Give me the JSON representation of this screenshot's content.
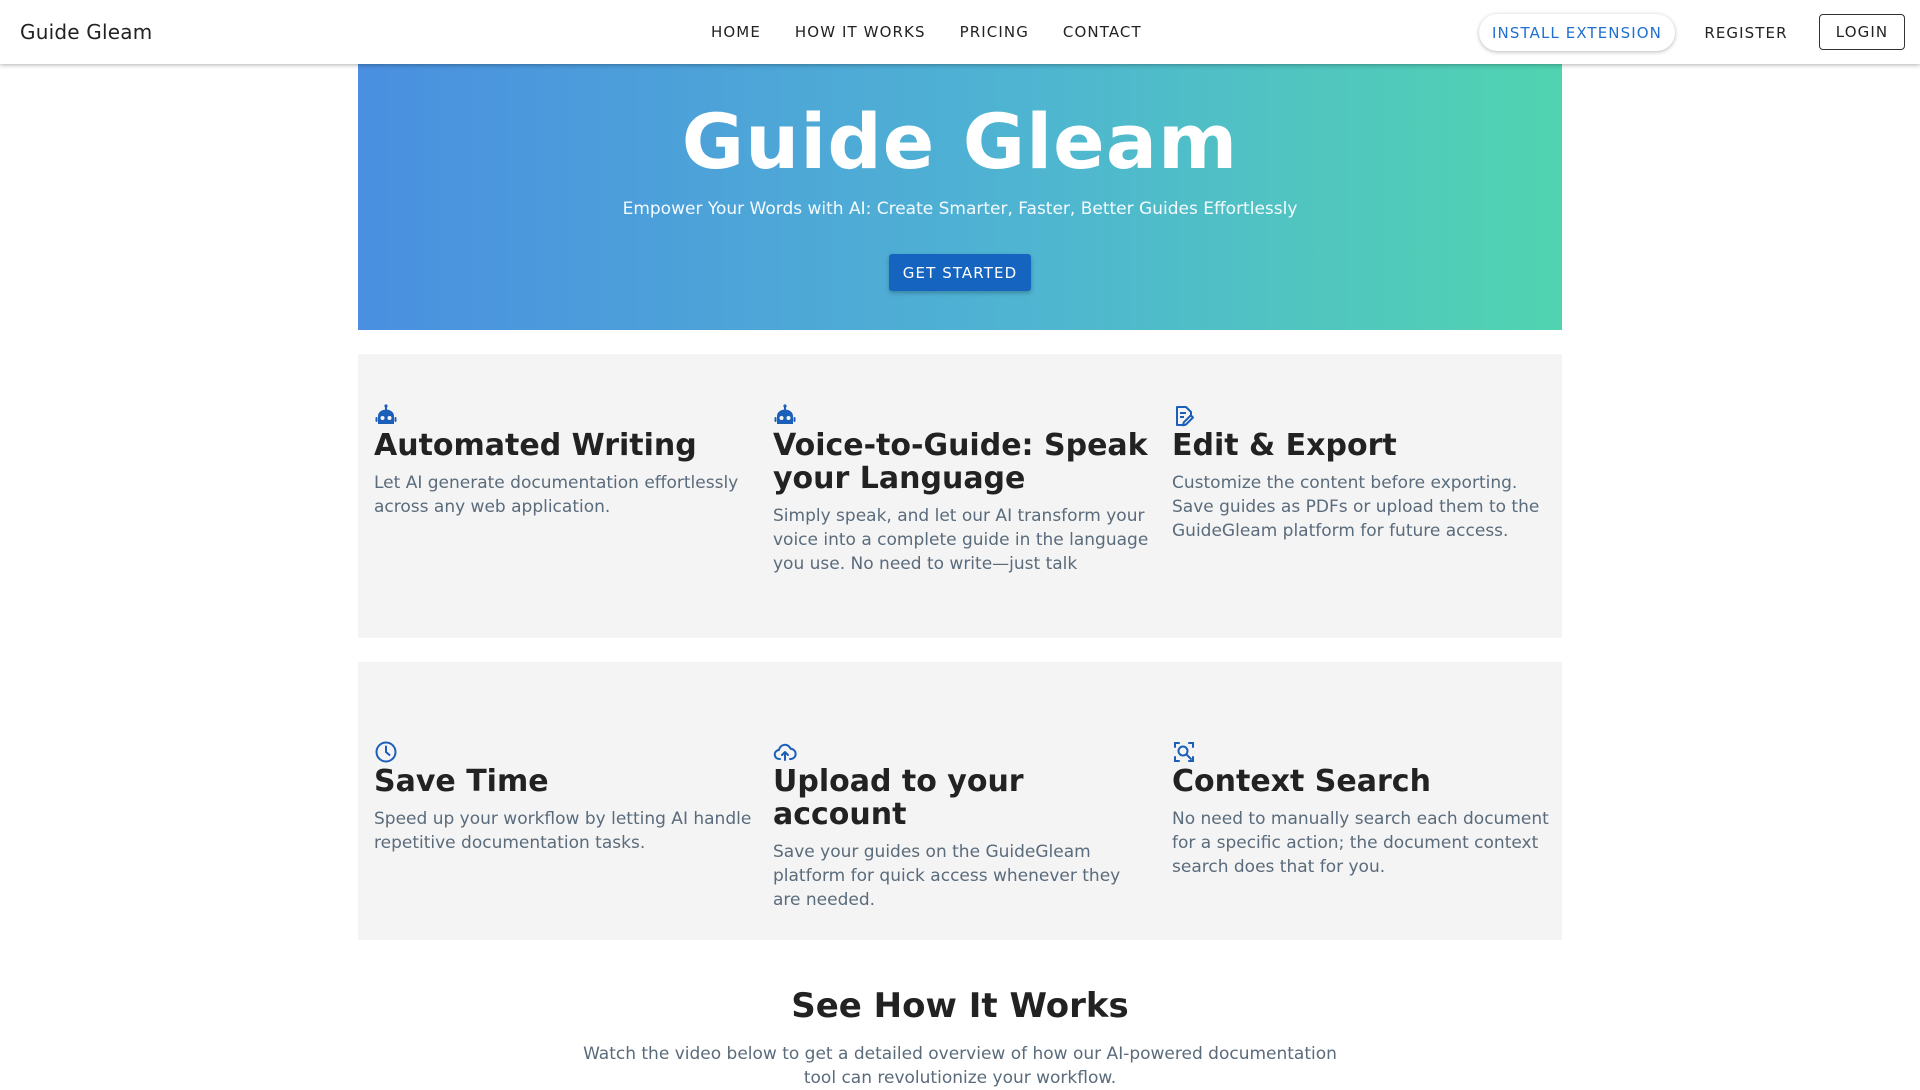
{
  "header": {
    "brand": "Guide Gleam",
    "nav": [
      "HOME",
      "HOW IT WORKS",
      "PRICING",
      "CONTACT"
    ],
    "install_label": "INSTALL EXTENSION",
    "register_label": "REGISTER",
    "login_label": "LOGIN"
  },
  "hero": {
    "title": "Guide Gleam",
    "subtitle": "Empower Your Words with AI: Create Smarter, Faster, Better Guides Effortlessly",
    "cta_label": "GET STARTED"
  },
  "features": [
    {
      "icon": "robot-icon",
      "title": "Automated Writing",
      "description": "Let AI generate documentation effortlessly across any web application."
    },
    {
      "icon": "robot-icon",
      "title": "Voice-to-Guide: Speak your Language",
      "description": "Simply speak, and let our AI transform your voice into a complete guide in the language you use. No need to write—just talk"
    },
    {
      "icon": "edit-document-icon",
      "title": "Edit & Export",
      "description": "Customize the content before exporting. Save guides as PDFs or upload them to the GuideGleam platform for future access."
    },
    {
      "icon": "clock-icon",
      "title": "Save Time",
      "description": "Speed up your workflow by letting AI handle repetitive documentation tasks."
    },
    {
      "icon": "cloud-upload-icon",
      "title": "Upload to your account",
      "description": "Save your guides on the GuideGleam platform for quick access whenever they are needed."
    },
    {
      "icon": "document-search-icon",
      "title": "Context Search",
      "description": "No need to manually search each document for a specific action; the document context search does that for you."
    }
  ],
  "how_it_works": {
    "title": "See How It Works",
    "subtitle": "Watch the video below to get a detailed overview of how our AI-powered documentation tool can revolutionize your workflow."
  },
  "colors": {
    "accent": "#1565c0",
    "icon": "#1c5fb8",
    "hero_gradient_start": "#4a8fe0",
    "hero_gradient_end": "#50d4b0",
    "panel_bg": "#f4f4f4"
  }
}
